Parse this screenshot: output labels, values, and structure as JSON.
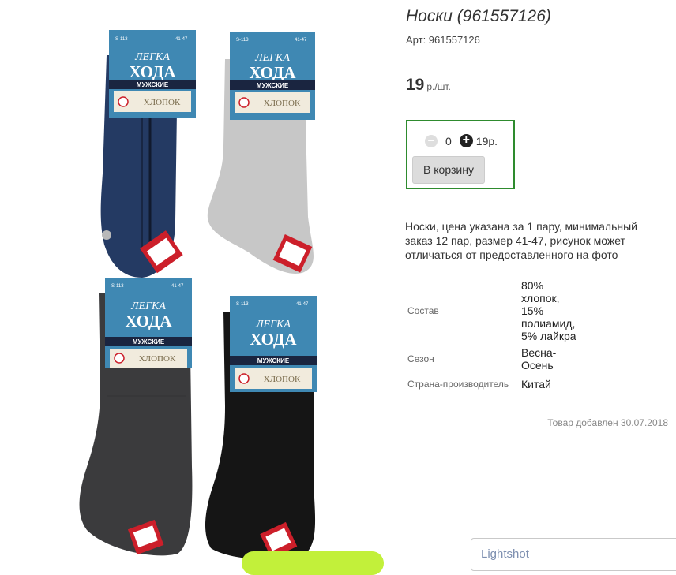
{
  "product": {
    "title": "Носки (961557126)",
    "article": "Арт: 961557126",
    "price_value": "19",
    "price_unit": "р./шт.",
    "description": "Носки, цена указана за 1 пару, минимальный заказ 12 пар, размер 41-47, рисунок может отличаться от предоставленного на фото",
    "added_date": "Товар добавлен 30.07.2018"
  },
  "cart": {
    "minus_glyph": "−",
    "quantity": "0",
    "plus_glyph": "+",
    "line_total": "19р.",
    "button_label": "В корзину"
  },
  "properties": [
    {
      "name": "Состав",
      "value": "80% хлопок, 15% полиамид, 5% лайкра"
    },
    {
      "name": "Сезон",
      "value": "Весна-Осень"
    },
    {
      "name": "Страна-производитель",
      "value": "Китай"
    }
  ],
  "gallery": {
    "socks": [
      {
        "color": "#243a63",
        "tag": {
          "sku": "S-113",
          "size": "41-47",
          "brand_top": "ЛЕГКА",
          "brand_bottom": "ХОДА",
          "gender": "МУЖСКИЕ",
          "material": "ХЛОПОК"
        }
      },
      {
        "color": "#c7c7c7",
        "tag": {
          "sku": "S-113",
          "size": "41-47",
          "brand_top": "ЛЕГКА",
          "brand_bottom": "ХОДА",
          "gender": "МУЖСКИЕ",
          "material": "ХЛОПОК"
        }
      },
      {
        "color": "#3b3b3d",
        "tag": {
          "sku": "S-113",
          "size": "41-47",
          "brand_top": "ЛЕГКА",
          "brand_bottom": "ХОДА",
          "gender": "МУЖСКИЕ",
          "material": "ХЛОПОК"
        }
      },
      {
        "color": "#151515",
        "tag": {
          "sku": "S-113",
          "size": "41-47",
          "brand_top": "ЛЕГКА",
          "brand_bottom": "ХОДА",
          "gender": "МУЖСКИЕ",
          "material": "ХЛОПОК"
        }
      }
    ]
  },
  "overlay": {
    "lightshot_label": "Lightshot"
  },
  "colors": {
    "buy_box_border": "#2e8b2e",
    "tag_blue": "#3f88b3",
    "label_red": "#cc1f2a",
    "overlay_green": "#c2f03a"
  }
}
